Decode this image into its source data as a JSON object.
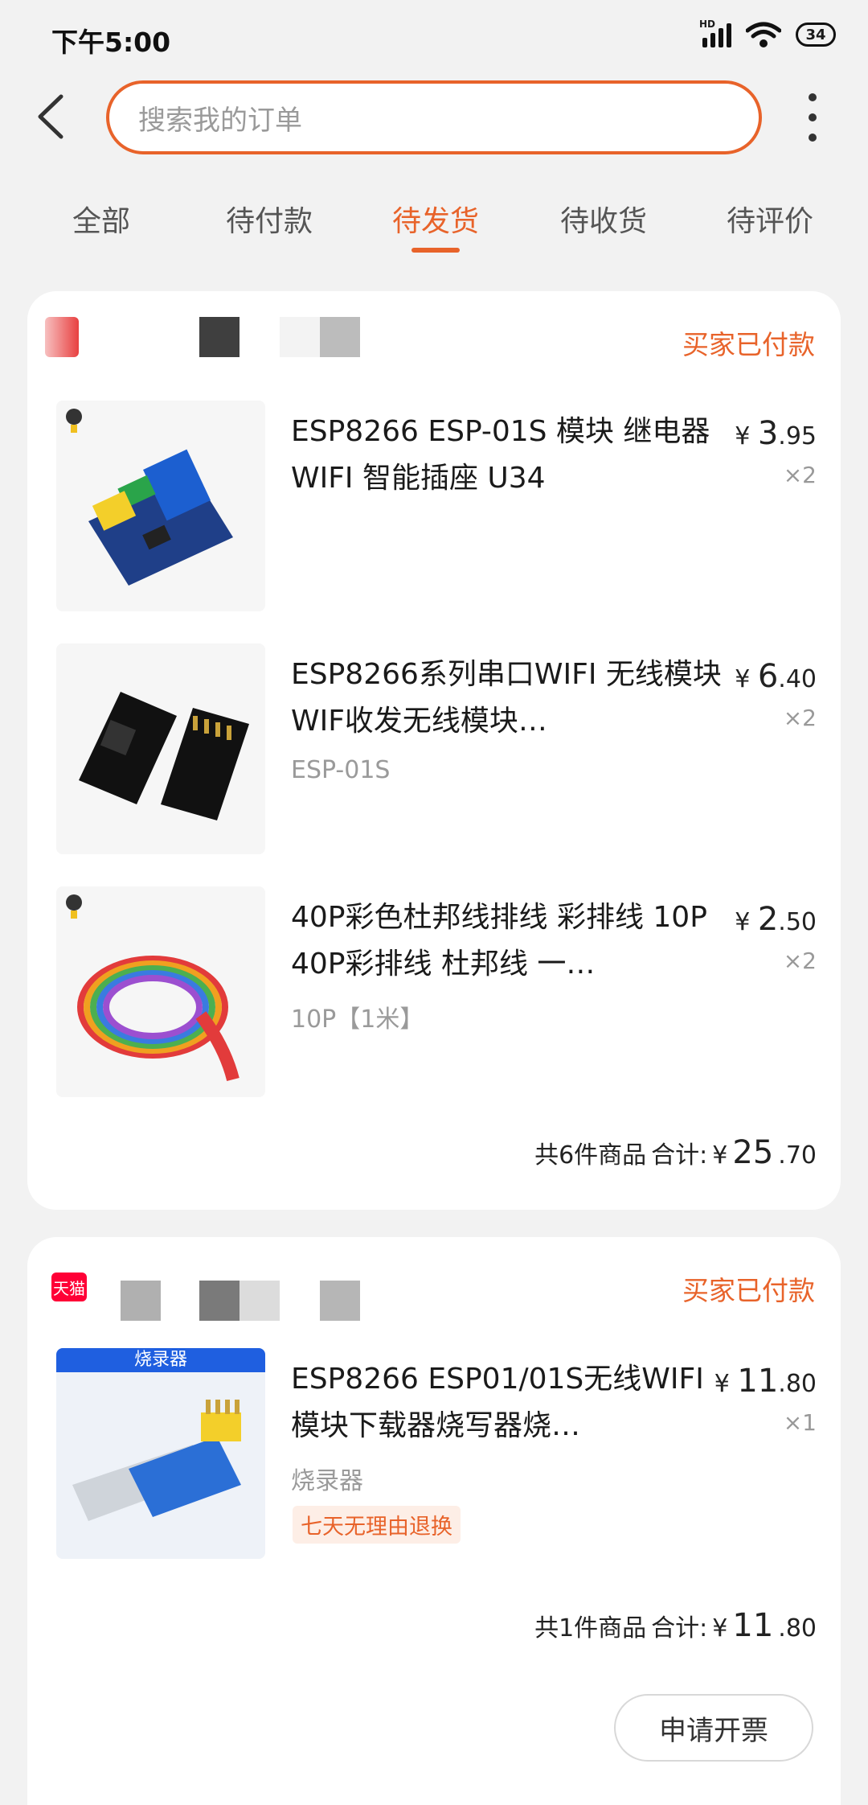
{
  "status_bar": {
    "time": "下午5:00",
    "battery": "34",
    "network_label": "HD"
  },
  "header": {
    "search_placeholder": "搜索我的订单"
  },
  "tabs": [
    {
      "label": "全部"
    },
    {
      "label": "待付款"
    },
    {
      "label": "待发货",
      "active": true
    },
    {
      "label": "待收货"
    },
    {
      "label": "待评价"
    }
  ],
  "orders": [
    {
      "status": "买家已付款",
      "items": [
        {
          "title": "ESP8266 ESP-01S 模块 继电器 WIFI 智能插座 U34",
          "sku": "",
          "price_symbol": "¥",
          "price_int": "3",
          "price_dec": ".95",
          "qty": "×2"
        },
        {
          "title": "ESP8266系列串口WIFI 无线模块 WIF收发无线模块…",
          "sku": "ESP-01S",
          "price_symbol": "¥",
          "price_int": "6",
          "price_dec": ".40",
          "qty": "×2"
        },
        {
          "title": "40P彩色杜邦线排线 彩排线 10P 40P彩排线 杜邦线 一…",
          "sku": "10P【1米】",
          "price_symbol": "¥",
          "price_int": "2",
          "price_dec": ".50",
          "qty": "×2"
        }
      ],
      "summary_count": "共6件商品",
      "summary_label": "合计:",
      "summary_symbol": "¥",
      "summary_int": "25",
      "summary_dec": ".70"
    },
    {
      "status": "买家已付款",
      "shop_logo": "天猫",
      "items": [
        {
          "title": "ESP8266 ESP01/01S无线WIFI模块下载器烧写器烧…",
          "sku": "烧录器",
          "banner": "烧录器",
          "tag": "七天无理由退换",
          "price_symbol": "¥",
          "price_int": "11",
          "price_dec": ".80",
          "qty": "×1"
        }
      ],
      "summary_count": "共1件商品",
      "summary_label": "合计:",
      "summary_symbol": "¥",
      "summary_int": "11",
      "summary_dec": ".80",
      "invoice_button": "申请开票"
    }
  ],
  "colors": {
    "accent": "#e8632a",
    "background": "#f2f2f2",
    "card": "#ffffff"
  }
}
